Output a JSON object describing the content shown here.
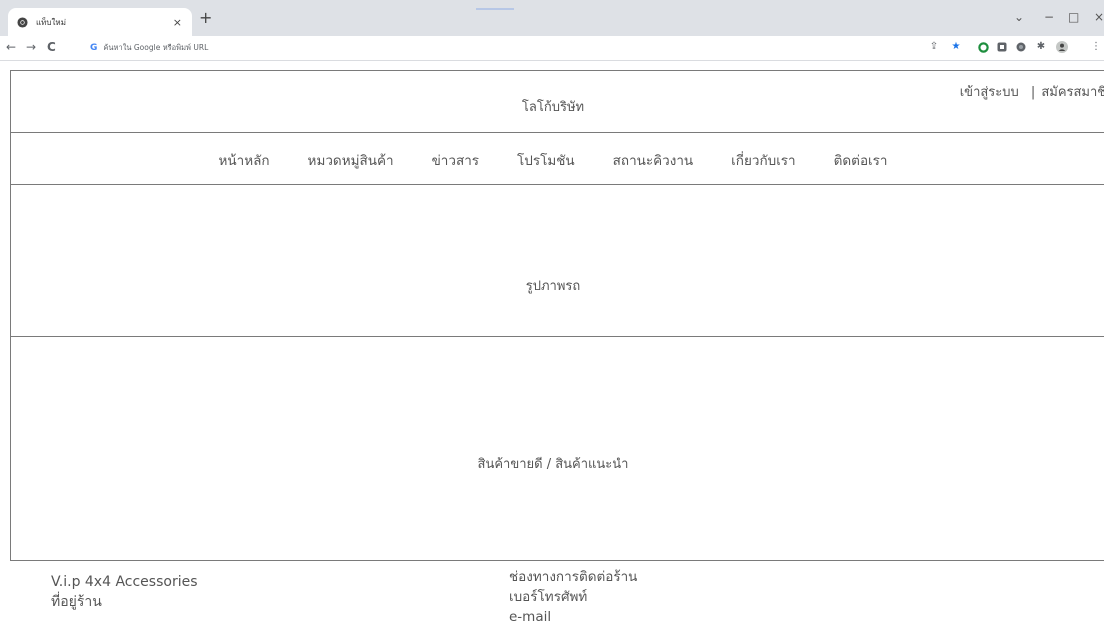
{
  "browser": {
    "tab_title": "แท็บใหม่",
    "tab_close": "×",
    "new_tab": "+",
    "omnibox_google": "G",
    "omnibox_placeholder": "ค้นหาใน Google หรือพิมพ์ URL",
    "nav": {
      "back": "←",
      "forward": "→",
      "reload": "C"
    },
    "window": {
      "minimize": "−",
      "maximize": "□",
      "close": "×",
      "tab_search": "⌄"
    },
    "colors": {
      "tabstrip": "#dee1e6",
      "star": "#1a73e8",
      "ext_green": "#1e8e3e"
    }
  },
  "header": {
    "logo_text": "โลโก้บริษัท",
    "login_link": "เข้าสู่ระบบ",
    "separator": "|",
    "register_link": "สมัครสมาชิก"
  },
  "nav": {
    "items": [
      "หน้าหลัก",
      "หมวดหมู่สินค้า",
      "ข่าวสาร",
      "โปรโมชัน",
      "สถานะคิวงาน",
      "เกี่ยวกับเรา",
      "ติดต่อเรา"
    ]
  },
  "banner": {
    "label": "รูปภาพรถ"
  },
  "products": {
    "label": "สินค้าขายดี / สินค้าแนะนำ"
  },
  "footer": {
    "shop_name": "V.i.p 4x4 Accessories",
    "address_label": "ที่อยู่ร้าน",
    "contact_title": "ช่องทางการติดต่อร้าน",
    "phone_label": "เบอร์โทรศัพท์",
    "email_label": "e-mail"
  }
}
